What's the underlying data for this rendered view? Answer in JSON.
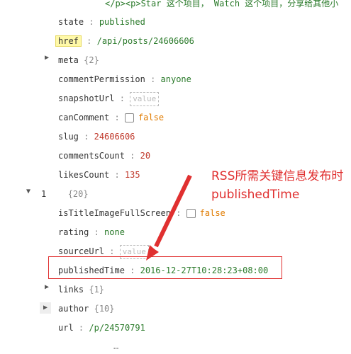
{
  "top_line": "</p><p>Star 这个项目，  Watch 这个项目，分享给其他小",
  "rows": {
    "state": {
      "key": "state",
      "value": "published"
    },
    "href": {
      "key": "href",
      "value": "/api/posts/24606606"
    },
    "meta": {
      "key": "meta",
      "value": "{2}"
    },
    "commentPermission": {
      "key": "commentPermission",
      "value": "anyone"
    },
    "snapshotUrl": {
      "key": "snapshotUrl",
      "placeholder": "value"
    },
    "canComment": {
      "key": "canComment",
      "value": "false"
    },
    "slug": {
      "key": "slug",
      "value": "24606606"
    },
    "commentsCount": {
      "key": "commentsCount",
      "value": "20"
    },
    "likesCount": {
      "key": "likesCount",
      "value": "135"
    },
    "index1": {
      "key": "1",
      "value": "{20}"
    },
    "isTitleImageFullScreen": {
      "key": "isTitleImageFullScreen",
      "value": "false"
    },
    "rating": {
      "key": "rating",
      "value": "none"
    },
    "sourceUrl": {
      "key": "sourceUrl",
      "placeholder": "value"
    },
    "publishedTime": {
      "key": "publishedTime",
      "value": "2016-12-27T10:28:23+08:00"
    },
    "links": {
      "key": "links",
      "value": "{1}"
    },
    "author": {
      "key": "author",
      "value": "{10}"
    },
    "url": {
      "key": "url",
      "value": "/p/24570791"
    }
  },
  "annotation": "RSS所需关键信息发布时publishedTime",
  "bottom_line": "…"
}
